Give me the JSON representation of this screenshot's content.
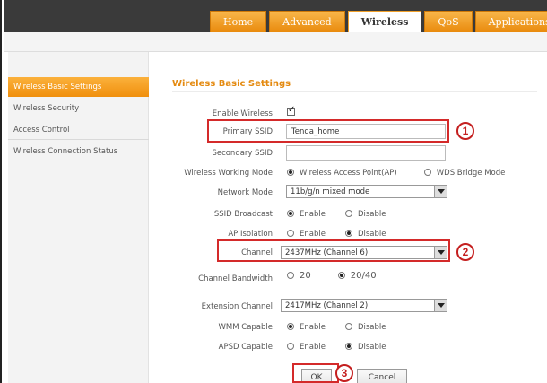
{
  "nav": {
    "tabs": [
      {
        "label": "Home"
      },
      {
        "label": "Advanced"
      },
      {
        "label": "Wireless"
      },
      {
        "label": "QoS"
      },
      {
        "label": "Applications"
      }
    ]
  },
  "sidebar": {
    "items": [
      {
        "label": "Wireless Basic Settings"
      },
      {
        "label": "Wireless Security"
      },
      {
        "label": "Access Control"
      },
      {
        "label": "Wireless Connection Status"
      }
    ]
  },
  "main": {
    "title": "Wireless Basic Settings",
    "enable_wireless": {
      "label": "Enable Wireless",
      "checked": true
    },
    "primary_ssid": {
      "label": "Primary SSID",
      "value": "Tenda_home"
    },
    "secondary_ssid": {
      "label": "Secondary SSID",
      "value": ""
    },
    "working_mode": {
      "label": "Wireless Working Mode",
      "options": [
        "Wireless Access Point(AP)",
        "WDS Bridge Mode"
      ],
      "selected": 0
    },
    "network_mode": {
      "label": "Network Mode",
      "value": "11b/g/n mixed mode"
    },
    "ssid_broadcast": {
      "label": "SSID Broadcast",
      "options": [
        "Enable",
        "Disable"
      ],
      "selected": 0
    },
    "ap_isolation": {
      "label": "AP Isolation",
      "options": [
        "Enable",
        "Disable"
      ],
      "selected": 1
    },
    "channel": {
      "label": "Channel",
      "value": "2437MHz (Channel 6)"
    },
    "channel_bandwidth": {
      "label": "Channel Bandwidth",
      "options": [
        "20",
        "20/40"
      ],
      "selected": 1
    },
    "extension_channel": {
      "label": "Extension Channel",
      "value": "2417MHz (Channel 2)"
    },
    "wmm_capable": {
      "label": "WMM Capable",
      "options": [
        "Enable",
        "Disable"
      ],
      "selected": 0
    },
    "apsd_capable": {
      "label": "APSD Capable",
      "options": [
        "Enable",
        "Disable"
      ],
      "selected": 1
    },
    "ok_label": "OK",
    "cancel_label": "Cancel"
  },
  "annotations": {
    "badge1": "1",
    "badge2": "2",
    "badge3": "3",
    "highlight_color": "#d42a2a"
  },
  "colors": {
    "accent": "#f08f0d",
    "title": "#e48a10",
    "topbar": "#3a3a3a"
  }
}
